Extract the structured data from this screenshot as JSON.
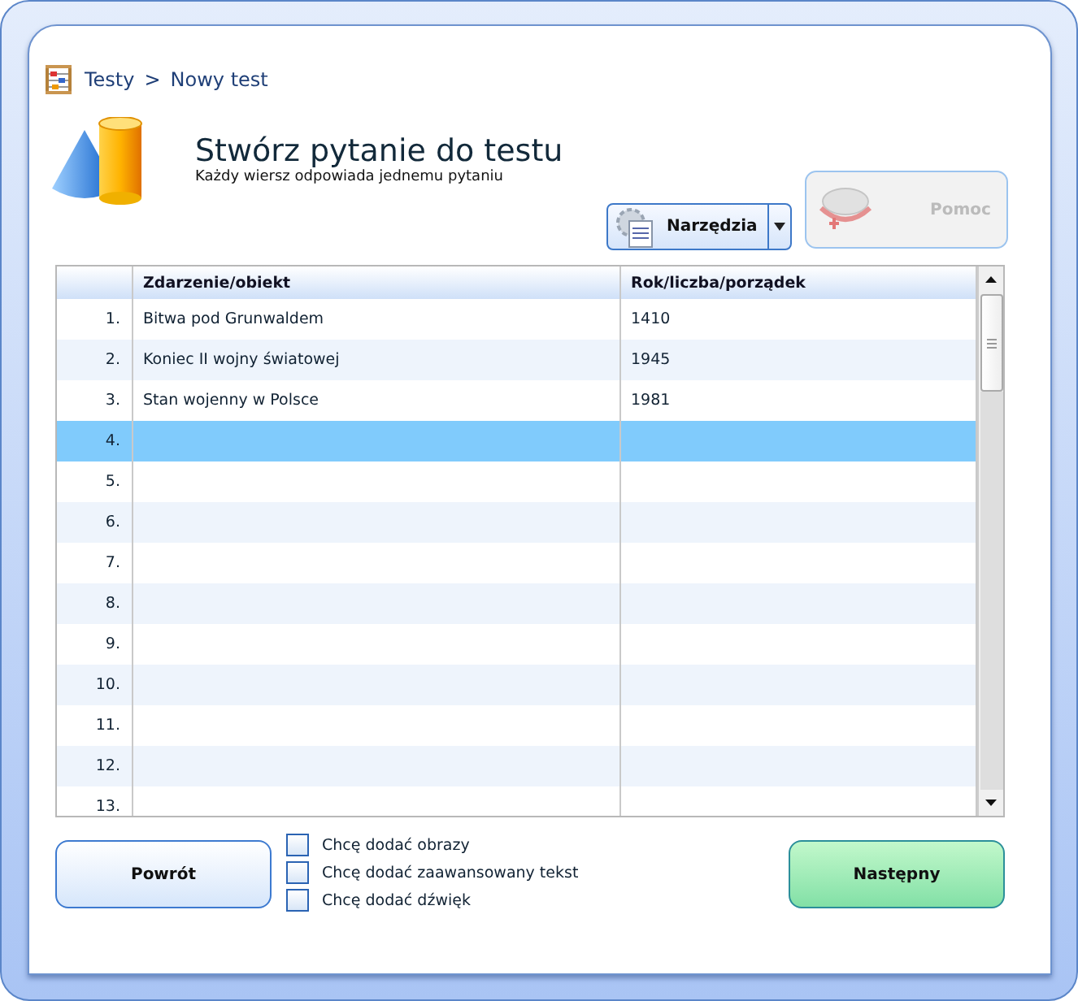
{
  "breadcrumb": {
    "root": "Testy",
    "separator": ">",
    "current": "Nowy test"
  },
  "heading": {
    "title": "Stwórz pytanie do testu",
    "subtitle": "Każdy wiersz odpowiada jednemu pytaniu"
  },
  "tools_button": {
    "label": "Narzędzia"
  },
  "help_button": {
    "label": "Pomoc",
    "disabled": true
  },
  "table": {
    "columns": [
      "Zdarzenie/obiekt",
      "Rok/liczba/porządek"
    ],
    "rows": [
      {
        "number": "1.",
        "event": "Bitwa pod Grunwaldem",
        "year": "1410",
        "selected": false
      },
      {
        "number": "2.",
        "event": "Koniec II wojny światowej",
        "year": "1945",
        "selected": false
      },
      {
        "number": "3.",
        "event": "Stan wojenny w Polsce",
        "year": "1981",
        "selected": false
      },
      {
        "number": "4.",
        "event": "",
        "year": "",
        "selected": true
      },
      {
        "number": "5.",
        "event": "",
        "year": "",
        "selected": false
      },
      {
        "number": "6.",
        "event": "",
        "year": "",
        "selected": false
      },
      {
        "number": "7.",
        "event": "",
        "year": "",
        "selected": false
      },
      {
        "number": "8.",
        "event": "",
        "year": "",
        "selected": false
      },
      {
        "number": "9.",
        "event": "",
        "year": "",
        "selected": false
      },
      {
        "number": "10.",
        "event": "",
        "year": "",
        "selected": false
      },
      {
        "number": "11.",
        "event": "",
        "year": "",
        "selected": false
      },
      {
        "number": "12.",
        "event": "",
        "year": "",
        "selected": false
      },
      {
        "number": "13.",
        "event": "",
        "year": "",
        "selected": false
      }
    ]
  },
  "options": [
    {
      "label": "Chcę dodać obrazy",
      "checked": false
    },
    {
      "label": "Chcę dodać zaawansowany tekst",
      "checked": false
    },
    {
      "label": "Chcę dodać dźwięk",
      "checked": false
    }
  ],
  "back_button": {
    "label": "Powrót"
  },
  "next_button": {
    "label": "Następny"
  }
}
